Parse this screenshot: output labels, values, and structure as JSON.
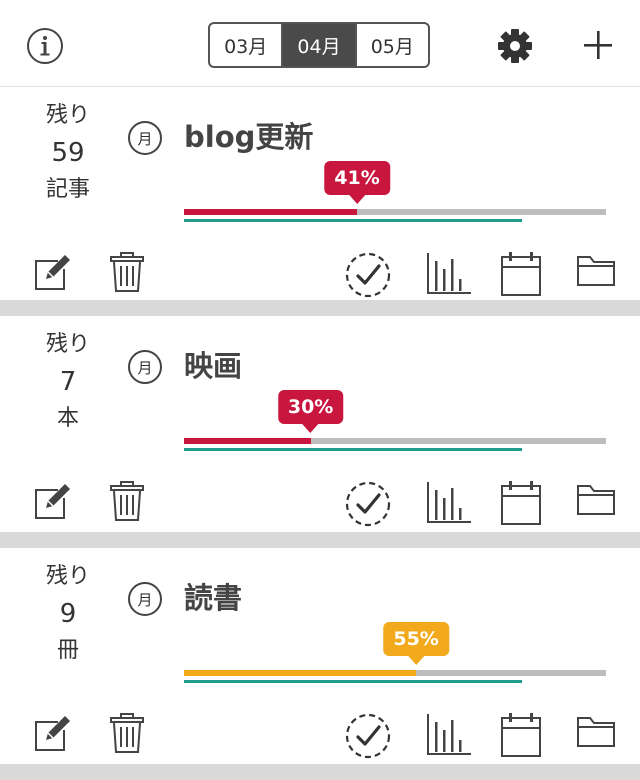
{
  "toolbar": {
    "months": [
      "03月",
      "04月",
      "05月"
    ],
    "selected_month": "04月"
  },
  "colors": {
    "crimson": "#c8163f",
    "amber": "#f2a91c",
    "teal": "#1f9e8e",
    "track_gray": "#bdbdbd",
    "icon": "#444444"
  },
  "goals": [
    {
      "remaining_label": "残り",
      "remaining_count": "59",
      "unit": "記事",
      "period": "月",
      "title": "blog更新",
      "progress_label": "41%",
      "progress": 0.41,
      "color": "#c8163f"
    },
    {
      "remaining_label": "残り",
      "remaining_count": "7",
      "unit": "本",
      "period": "月",
      "title": "映画",
      "progress_label": "30%",
      "progress": 0.3,
      "color": "#c8163f"
    },
    {
      "remaining_label": "残り",
      "remaining_count": "9",
      "unit": "冊",
      "period": "月",
      "title": "読書",
      "progress_label": "55%",
      "progress": 0.55,
      "color": "#f2a91c"
    }
  ],
  "icons": {
    "info": "info-icon",
    "settings": "gear-icon",
    "add": "plus-icon",
    "edit": "edit-icon",
    "delete": "trash-icon",
    "complete": "check-circle-icon",
    "stats": "bar-chart-icon",
    "calendar": "calendar-icon",
    "folder": "folder-icon"
  }
}
